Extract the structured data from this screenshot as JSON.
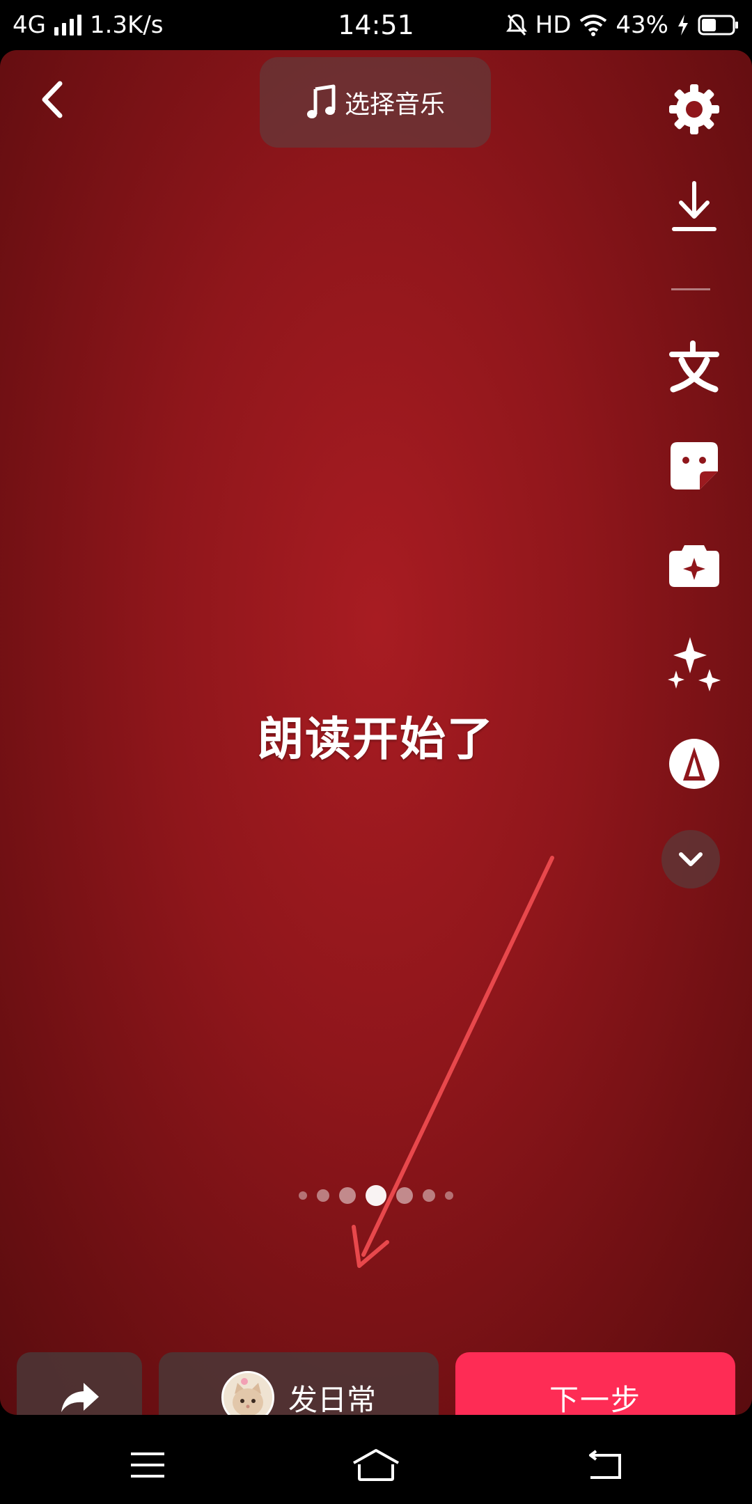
{
  "status_bar": {
    "network": "4G",
    "speed": "1.3K/s",
    "time": "14:51",
    "hd": "HD",
    "battery": "43%"
  },
  "top": {
    "music_label": "选择音乐"
  },
  "right_tools": [
    "settings-icon",
    "download-icon",
    "text-icon",
    "sticker-icon",
    "effects-icon",
    "enhance-icon",
    "filter-icon",
    "expand-more-icon"
  ],
  "canvas": {
    "center_text": "朗读开始了",
    "page_dots": 7,
    "active_dot": 4
  },
  "bottom": {
    "daily_label": "发日常",
    "next_label": "下一步"
  },
  "colors": {
    "accent": "#fe2c55",
    "background_red": "#8f161b",
    "annotation_arrow": "#e8484c"
  }
}
